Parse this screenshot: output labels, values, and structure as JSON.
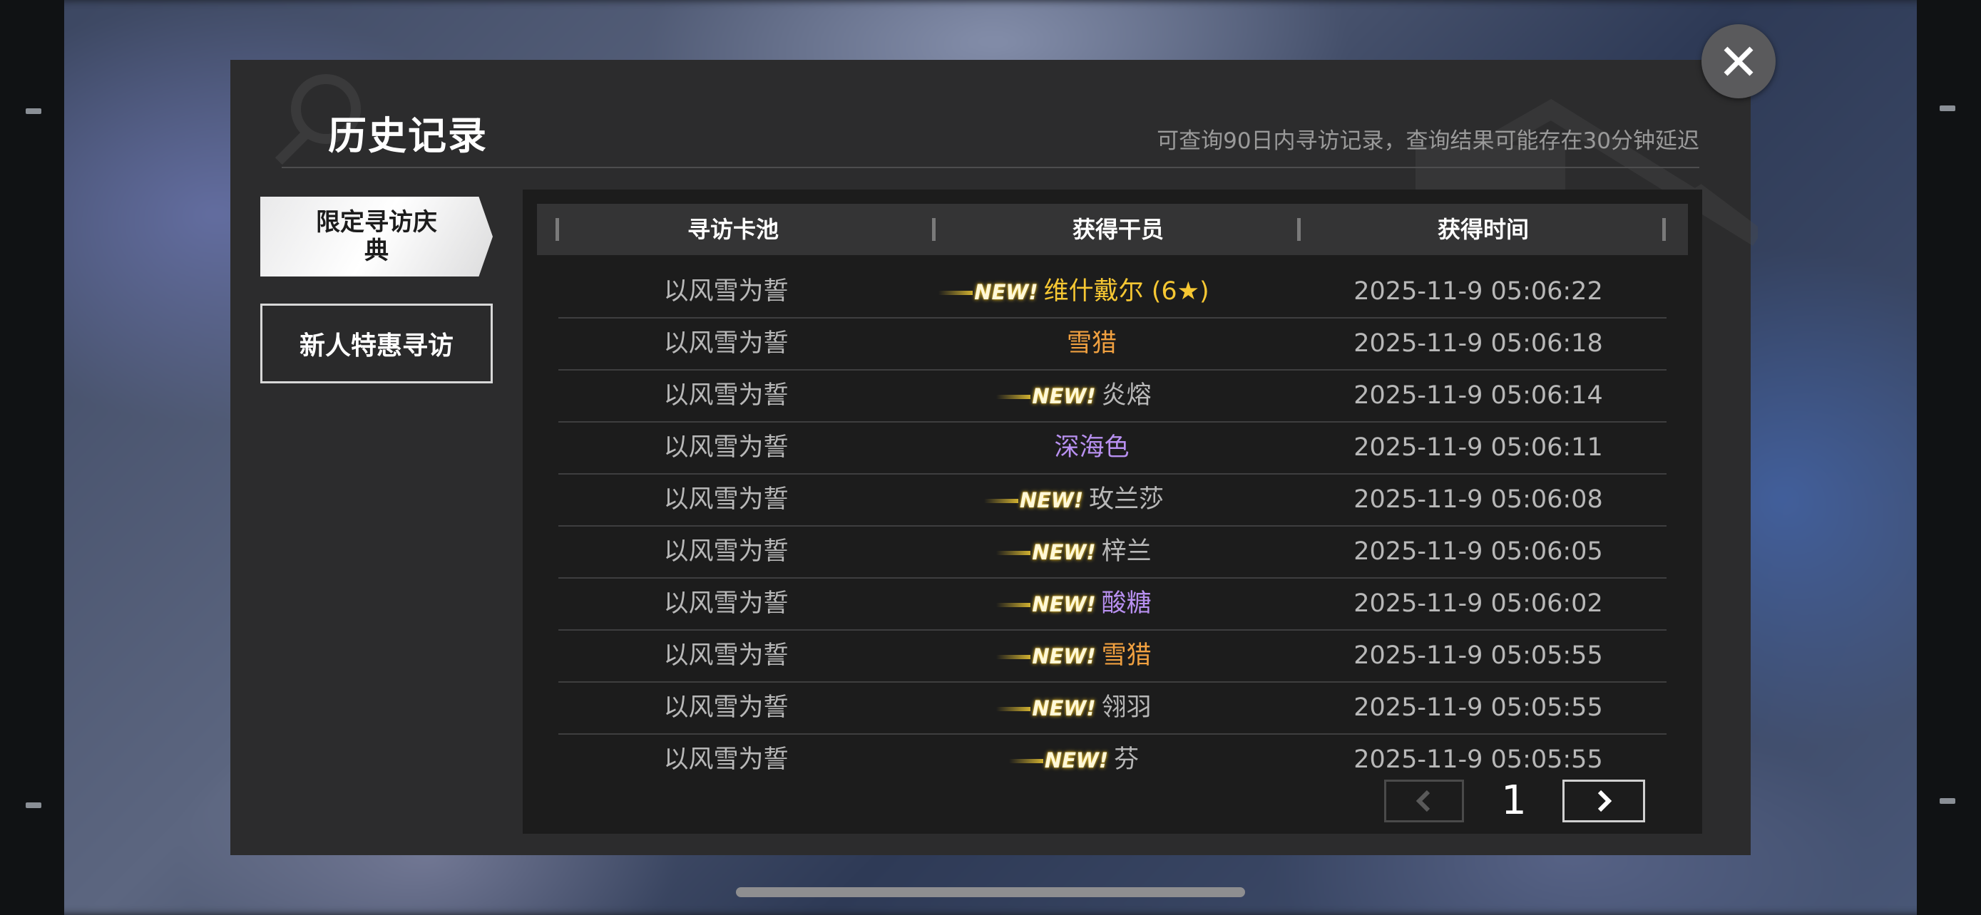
{
  "dialog": {
    "title": "历史记录",
    "note": "可查询90日内寻访记录，查询结果可能存在30分钟延迟"
  },
  "tabs": [
    {
      "label": "限定寻访庆典",
      "active": true
    },
    {
      "label": "新人特惠寻访",
      "active": false
    }
  ],
  "table": {
    "headers": [
      "寻访卡池",
      "获得干员",
      "获得时间"
    ],
    "new_tag": "NEW!",
    "rows": [
      {
        "pool": "以风雪为誓",
        "new": true,
        "operator": "维什戴尔 (6★)",
        "color": "#f6c733",
        "time": "2025-11-9 05:06:22"
      },
      {
        "pool": "以风雪为誓",
        "new": false,
        "operator": "雪猎",
        "color": "#f0a040",
        "time": "2025-11-9 05:06:18"
      },
      {
        "pool": "以风雪为誓",
        "new": true,
        "operator": "炎熔",
        "color": "#b8b8b8",
        "time": "2025-11-9 05:06:14"
      },
      {
        "pool": "以风雪为誓",
        "new": false,
        "operator": "深海色",
        "color": "#b890f0",
        "time": "2025-11-9 05:06:11"
      },
      {
        "pool": "以风雪为誓",
        "new": true,
        "operator": "玫兰莎",
        "color": "#b8b8b8",
        "time": "2025-11-9 05:06:08"
      },
      {
        "pool": "以风雪为誓",
        "new": true,
        "operator": "梓兰",
        "color": "#b8b8b8",
        "time": "2025-11-9 05:06:05"
      },
      {
        "pool": "以风雪为誓",
        "new": true,
        "operator": "酸糖",
        "color": "#b890f0",
        "time": "2025-11-9 05:06:02"
      },
      {
        "pool": "以风雪为誓",
        "new": true,
        "operator": "雪猎",
        "color": "#f0a040",
        "time": "2025-11-9 05:05:55"
      },
      {
        "pool": "以风雪为誓",
        "new": true,
        "operator": "翎羽",
        "color": "#b8b8b8",
        "time": "2025-11-9 05:05:55"
      },
      {
        "pool": "以风雪为誓",
        "new": true,
        "operator": "芬",
        "color": "#b8b8b8",
        "time": "2025-11-9 05:05:55"
      }
    ]
  },
  "pager": {
    "current_page": "1",
    "prev_icon": "chevron-left-icon",
    "next_icon": "chevron-right-icon"
  },
  "close_icon": "close-icon"
}
